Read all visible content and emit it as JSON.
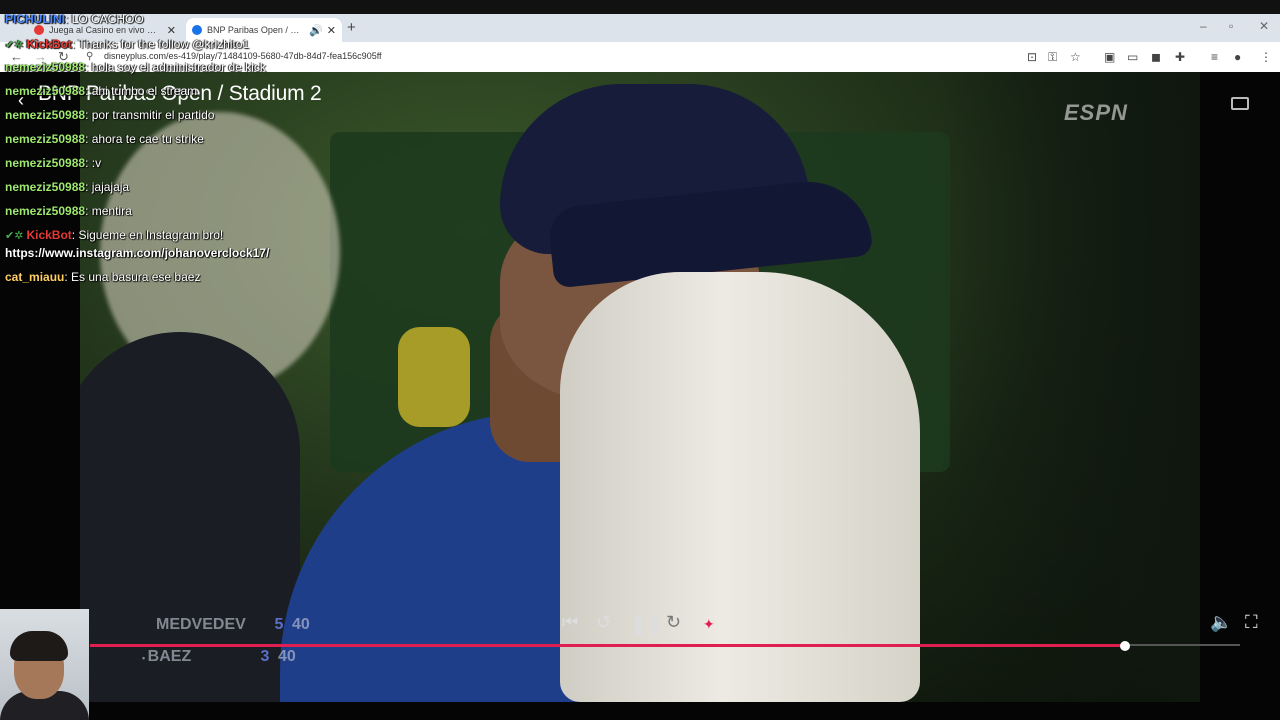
{
  "browser": {
    "tabs": [
      {
        "title": "Juega al Casino en vivo Online",
        "favicon_color": "#e53935"
      },
      {
        "title": "BNP Paribas Open / Stadiu...",
        "favicon_color": "#1a73e8"
      }
    ],
    "url": "disneyplus.com/es-419/play/71484109-5680-47db-84d7-fea156c905ff"
  },
  "player": {
    "title": "BNP Paribas Open / Stadium 2",
    "network_logo": "ESPN",
    "scoreboard": [
      {
        "name": "MEDVEDEV",
        "games": "5",
        "points": "40"
      },
      {
        "name": "BAEZ",
        "games": "3",
        "points": "40"
      }
    ],
    "progress_fraction": 0.9
  },
  "chat": [
    {
      "user": "PICHULINI",
      "text": "LO CACHOO",
      "color": "pich"
    },
    {
      "user": "KickBot",
      "text": "Thanks for the follow @krizhito1",
      "color": "kick",
      "bot": true
    },
    {
      "user": "nemeziz50988",
      "text": "hola soy el administrador de kick",
      "color": "nem"
    },
    {
      "user": "nemeziz50988",
      "text": "ahi tumbo el stream",
      "color": "nem"
    },
    {
      "user": "nemeziz50988",
      "text": "por transmitir el partido",
      "color": "nem"
    },
    {
      "user": "nemeziz50988",
      "text": "ahora te cae tu strike",
      "color": "nem"
    },
    {
      "user": "nemeziz50988",
      "text": ":v",
      "color": "nem"
    },
    {
      "user": "nemeziz50988",
      "text": "jajajaja",
      "color": "nem"
    },
    {
      "user": "nemeziz50988",
      "text": "mentira",
      "color": "nem"
    },
    {
      "user": "KickBot",
      "text": "Sigueme en Instagram bro!",
      "color": "kick",
      "bot": true
    },
    {
      "user": "",
      "text": "https://www.instagram.com/johanoverclock17/",
      "color": "none"
    },
    {
      "user": "cat_miauu",
      "text": "Es una basura ese baez",
      "color": "cat"
    }
  ]
}
